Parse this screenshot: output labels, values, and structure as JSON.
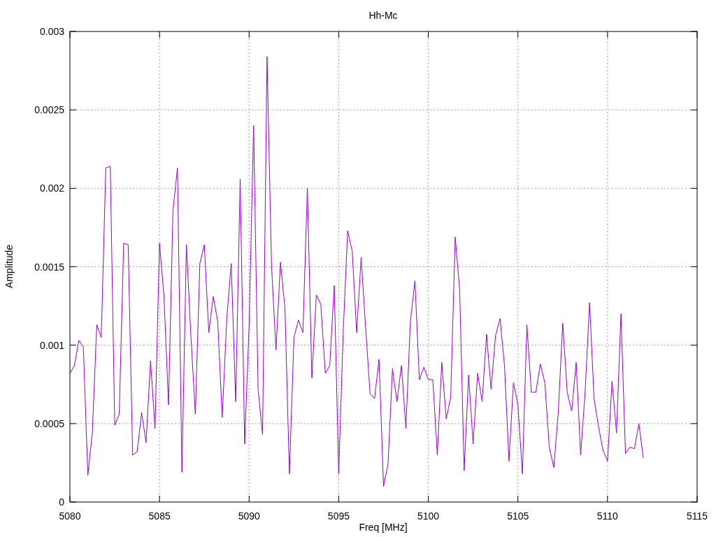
{
  "chart_data": {
    "type": "line",
    "title": "Hh-Mc",
    "xlabel": "Freq [MHz]",
    "ylabel": "Amplitude",
    "xlim": [
      5080,
      5115
    ],
    "grid": true,
    "ylim": [
      0,
      0.003
    ],
    "xticks": [
      5080,
      5085,
      5090,
      5095,
      5100,
      5105,
      5110,
      5115
    ],
    "yticks": [
      {
        "value": 0,
        "label": "0"
      },
      {
        "value": 0.0005,
        "label": "0.0005"
      },
      {
        "value": 0.001,
        "label": "0.001"
      },
      {
        "value": 0.0015,
        "label": "0.0015"
      },
      {
        "value": 0.002,
        "label": "0.002"
      },
      {
        "value": 0.0025,
        "label": "0.0025"
      },
      {
        "value": 0.003,
        "label": "0.003"
      }
    ],
    "x": [
      5080,
      5080.25,
      5080.5,
      5080.75,
      5081,
      5081.25,
      5081.5,
      5081.75,
      5082,
      5082.25,
      5082.5,
      5082.75,
      5083,
      5083.25,
      5083.5,
      5083.75,
      5084,
      5084.25,
      5084.5,
      5084.75,
      5085,
      5085.25,
      5085.5,
      5085.75,
      5086,
      5086.25,
      5086.5,
      5086.75,
      5087,
      5087.25,
      5087.5,
      5087.75,
      5088,
      5088.25,
      5088.5,
      5088.75,
      5089,
      5089.25,
      5089.5,
      5089.75,
      5090,
      5090.25,
      5090.5,
      5090.75,
      5091,
      5091.25,
      5091.5,
      5091.75,
      5092,
      5092.25,
      5092.5,
      5092.75,
      5093,
      5093.25,
      5093.5,
      5093.75,
      5094,
      5094.25,
      5094.5,
      5094.75,
      5095,
      5095.25,
      5095.5,
      5095.75,
      5096,
      5096.25,
      5096.5,
      5096.75,
      5097,
      5097.25,
      5097.5,
      5097.75,
      5098,
      5098.25,
      5098.5,
      5098.75,
      5099,
      5099.25,
      5099.5,
      5099.75,
      5100,
      5100.25,
      5100.5,
      5100.75,
      5101,
      5101.25,
      5101.5,
      5101.75,
      5102,
      5102.25,
      5102.5,
      5102.75,
      5103,
      5103.25,
      5103.5,
      5103.75,
      5104,
      5104.25,
      5104.5,
      5104.75,
      5105,
      5105.25,
      5105.5,
      5105.75,
      5106,
      5106.25,
      5106.5,
      5106.75,
      5107,
      5107.25,
      5107.5,
      5107.75,
      5108,
      5108.25,
      5108.5,
      5108.75,
      5109,
      5109.25,
      5109.5,
      5109.75,
      5110,
      5110.25,
      5110.5,
      5110.75,
      5111,
      5111.25,
      5111.5,
      5111.75,
      5112
    ],
    "series": [
      {
        "color": "#9400d3",
        "values": [
          0.00082,
          0.00087,
          0.00103,
          0.00099,
          0.00017,
          0.00044,
          0.00113,
          0.00105,
          0.00213,
          0.00214,
          0.00049,
          0.00056,
          0.00165,
          0.00164,
          0.0003,
          0.00032,
          0.00057,
          0.00038,
          0.0009,
          0.00047,
          0.00165,
          0.00131,
          0.00062,
          0.00186,
          0.00213,
          0.00019,
          0.00164,
          0.00106,
          0.00056,
          0.00152,
          0.00164,
          0.00108,
          0.00131,
          0.00115,
          0.00054,
          0.00117,
          0.00152,
          0.00064,
          0.00206,
          0.00037,
          0.00113,
          0.0024,
          0.00072,
          0.00043,
          0.00284,
          0.00151,
          0.00097,
          0.00153,
          0.00124,
          0.00018,
          0.00105,
          0.00116,
          0.00108,
          0.002,
          0.00079,
          0.00132,
          0.00126,
          0.00082,
          0.00087,
          0.00138,
          0.00018,
          0.00108,
          0.00173,
          0.0016,
          0.00108,
          0.00156,
          0.00111,
          0.00069,
          0.00066,
          0.00091,
          0.0001,
          0.00024,
          0.00085,
          0.00064,
          0.00087,
          0.00047,
          0.00115,
          0.00141,
          0.00078,
          0.00086,
          0.00078,
          0.00078,
          0.0003,
          0.00089,
          0.00053,
          0.00067,
          0.00169,
          0.00135,
          0.0002,
          0.00081,
          0.00037,
          0.00082,
          0.00064,
          0.00107,
          0.00072,
          0.00106,
          0.00117,
          0.00087,
          0.00026,
          0.00076,
          0.00062,
          0.00018,
          0.00113,
          0.0007,
          0.0007,
          0.00088,
          0.00076,
          0.00035,
          0.00022,
          0.00057,
          0.00114,
          0.0007,
          0.00058,
          0.00089,
          0.0003,
          0.0007,
          0.00127,
          0.00066,
          0.00048,
          0.00033,
          0.00026,
          0.00077,
          0.00044,
          0.0012,
          0.00031,
          0.00035,
          0.00034,
          0.0005,
          0.00028
        ]
      }
    ]
  }
}
